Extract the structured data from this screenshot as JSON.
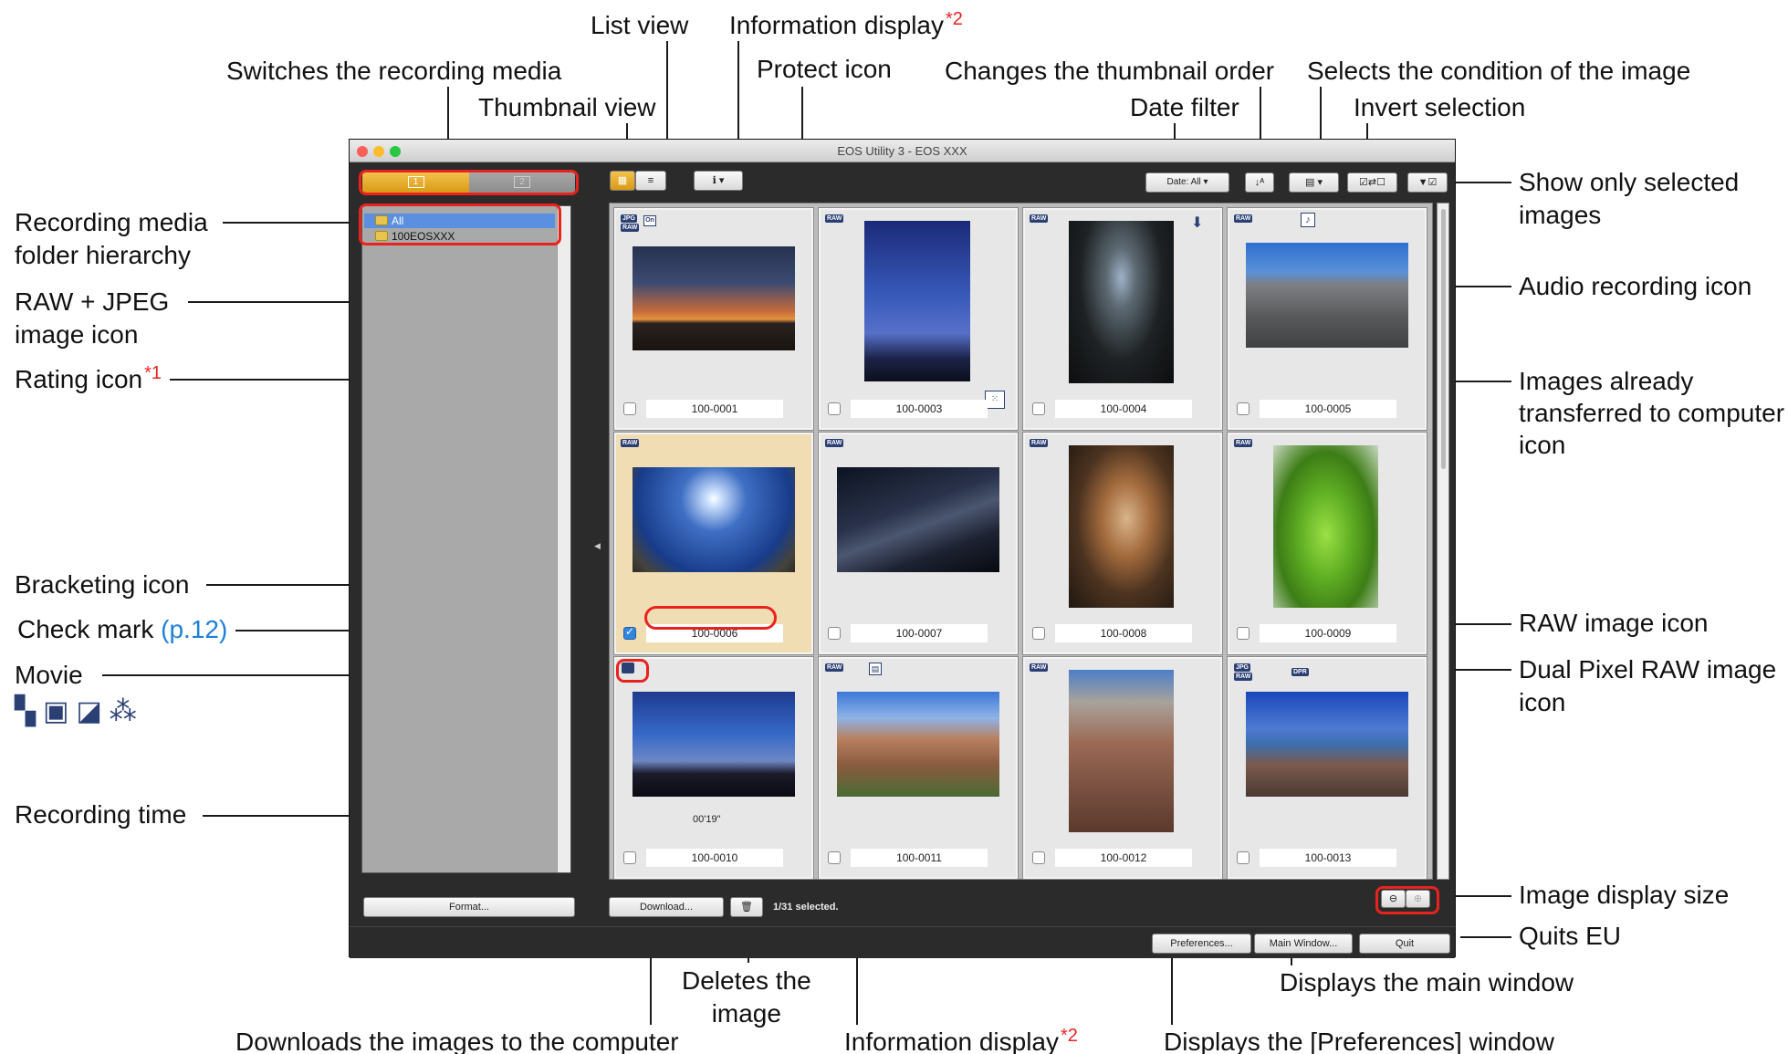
{
  "window": {
    "title": "EOS Utility 3 - EOS XXX",
    "colors": {
      "accent": "#d99a16",
      "window_bg": "#2b2b2b",
      "annotation_red": "#e8231e"
    }
  },
  "media_switch": {
    "slot1": "1",
    "slot2": "2"
  },
  "folders": [
    {
      "label": "All",
      "selected": true
    },
    {
      "label": "100EOSXXX",
      "selected": false
    }
  ],
  "toolbar": {
    "thumb_view_icon": "grid-icon",
    "list_view_icon": "list-icon",
    "info_display_icon": "info-icon",
    "date_filter": "Date: All",
    "sort_icon": "sort-icon",
    "condition_icon": "condition-icon",
    "invert_icon": "invert-icon",
    "selected_only_icon": "filter-icon"
  },
  "thumbnails": [
    {
      "file": "100-0001",
      "badges": [
        "JPEG",
        "RAW"
      ],
      "icons": [
        "protect"
      ],
      "checked": false
    },
    {
      "file": "100-0003",
      "badges": [
        "RAW"
      ],
      "icons": [
        "rating"
      ],
      "checked": false
    },
    {
      "file": "100-0004",
      "badges": [
        "RAW"
      ],
      "icons": [
        "transferred"
      ],
      "checked": false
    },
    {
      "file": "100-0005",
      "badges": [
        "RAW"
      ],
      "icons": [
        "audio"
      ],
      "checked": false
    },
    {
      "file": "100-0006",
      "badges": [
        "RAW"
      ],
      "icons": [],
      "checked": true
    },
    {
      "file": "100-0007",
      "badges": [
        "RAW"
      ],
      "icons": [],
      "checked": false
    },
    {
      "file": "100-0008",
      "badges": [
        "RAW"
      ],
      "icons": [],
      "checked": false
    },
    {
      "file": "100-0009",
      "badges": [
        "RAW"
      ],
      "icons": [],
      "checked": false
    },
    {
      "file": "100-0010",
      "badges": [],
      "icons": [
        "movie"
      ],
      "checked": false,
      "time": "00'19\""
    },
    {
      "file": "100-0011",
      "badges": [
        "RAW"
      ],
      "icons": [
        "bracketing"
      ],
      "checked": false
    },
    {
      "file": "100-0012",
      "badges": [
        "RAW"
      ],
      "icons": [],
      "checked": false
    },
    {
      "file": "100-0013",
      "badges": [
        "JPEG",
        "RAW",
        "DPR"
      ],
      "icons": [],
      "checked": false
    }
  ],
  "bottom": {
    "format": "Format...",
    "download": "Download...",
    "selected_status": "1/31 selected.",
    "preferences": "Preferences...",
    "main_window": "Main Window...",
    "quit": "Quit"
  },
  "annotations": {
    "list_view": "List view",
    "info_display": "Information display",
    "sup2": "*2",
    "sup1": "*1",
    "switch_media": "Switches the recording media",
    "protect_icon": "Protect icon",
    "change_order": "Changes the thumbnail order",
    "select_condition": "Selects the condition of the image",
    "thumbnail_view": "Thumbnail view",
    "date_filter": "Date filter",
    "invert_selection": "Invert selection",
    "media_folder_1": "Recording media",
    "media_folder_2": "folder hierarchy",
    "raw_jpeg_1": "RAW + JPEG",
    "raw_jpeg_2": "image icon",
    "rating_icon": "Rating icon",
    "show_selected_1": "Show only selected",
    "show_selected_2": "images",
    "audio_icon": "Audio recording icon",
    "transferred_1": "Images already",
    "transferred_2": "transferred to computer",
    "transferred_3": "icon",
    "bracketing_icon": "Bracketing icon",
    "check_mark": "Check mark ",
    "check_mark_ref": "(p.12)",
    "movie": "Movie",
    "raw_icon": "RAW image icon",
    "dual_pixel_1": "Dual Pixel RAW image",
    "dual_pixel_2": "icon",
    "recording_time": "Recording time",
    "display_size": "Image display size",
    "quits": "Quits EU",
    "deletes_1": "Deletes the",
    "deletes_2": "image",
    "displays_main": "Displays the main window",
    "downloads": "Downloads the images to the computer",
    "info_display_bottom": "Information display",
    "preferences_window": "Displays the [Preferences] window"
  }
}
